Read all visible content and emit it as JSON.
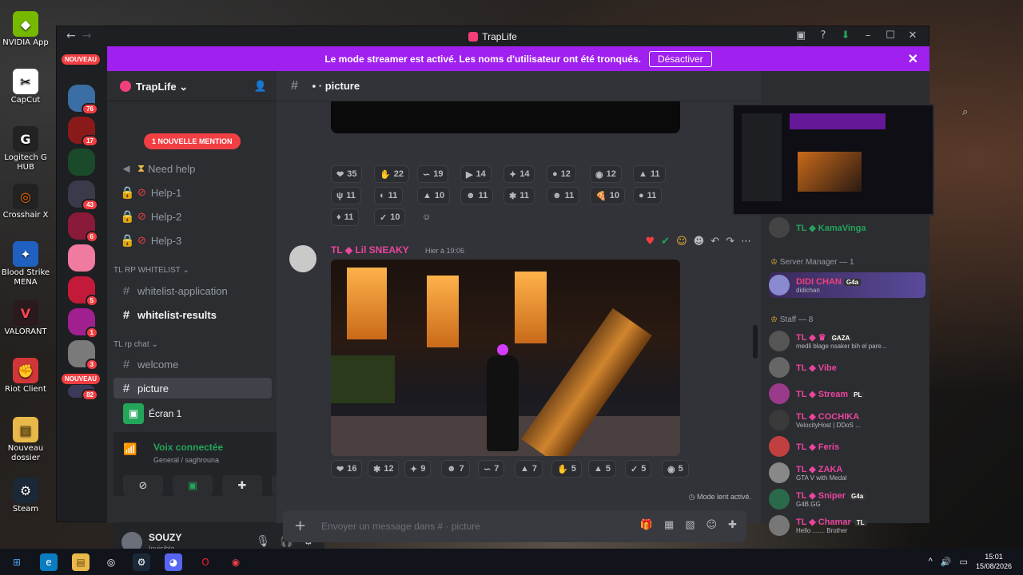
{
  "desktop": {
    "icons": [
      {
        "label": "NVIDIA App",
        "icon": "nvidia-icon",
        "color": "#76b900"
      },
      {
        "label": "CapCut",
        "icon": "capcut-icon",
        "color": "#111111"
      },
      {
        "label": "Logitech G HUB",
        "icon": "logitech-icon",
        "color": "#222222"
      },
      {
        "label": "Crosshair X",
        "icon": "crosshair-icon",
        "color": "#ff6a00"
      },
      {
        "label": "Blood Strike MENA",
        "icon": "bloodstrike-icon",
        "color": "#2060c0"
      },
      {
        "label": "VALORANT",
        "icon": "valorant-icon",
        "color": "#fa4454"
      },
      {
        "label": "Riot Client",
        "icon": "riot-icon",
        "color": "#d13639"
      },
      {
        "label": "Nouveau dossier",
        "icon": "folder-icon",
        "color": "#e8b84a"
      },
      {
        "label": "Steam",
        "icon": "steam-icon",
        "color": "#1b2838"
      }
    ]
  },
  "window": {
    "title": "TrapLife",
    "banner_text": "Le mode streamer est activé. Les noms d'utilisateur ont été tronqués.",
    "banner_button": "Désactiver"
  },
  "servers": {
    "new_label": "NOUVEAU",
    "badges": [
      "76",
      "17",
      "43",
      "6",
      "5",
      "1",
      "3",
      "82"
    ]
  },
  "sidebar": {
    "guild_name": "TrapLife",
    "mention_pill": "1 NOUVELLE MENTION",
    "channels": [
      {
        "label": "Need help"
      },
      {
        "label": "Help-1"
      },
      {
        "label": "Help-2"
      },
      {
        "label": "Help-3"
      }
    ],
    "category_whitelist": "TL RP WHITELIST",
    "whitelist_application": "whitelist-application",
    "whitelist_results": "whitelist-results",
    "category_chat": "TL rp chat",
    "welcome": "welcome",
    "picture": "picture",
    "screen_label": "Écran 1",
    "voice_status": "Voix connectée",
    "voice_channel": "General / saghrouna",
    "user_name": "SOUZY",
    "user_status": "Invisible"
  },
  "chat": {
    "channel_name": "picture",
    "reactions_top": [
      {
        "emoji": "❤",
        "count": "35"
      },
      {
        "emoji": "✋",
        "count": "22"
      },
      {
        "emoji": "∽",
        "count": "19"
      },
      {
        "emoji": "▶",
        "count": "14"
      },
      {
        "emoji": "✦",
        "count": "14"
      },
      {
        "emoji": "●",
        "count": "12"
      },
      {
        "emoji": "◉",
        "count": "12"
      },
      {
        "emoji": "▲",
        "count": "11"
      },
      {
        "emoji": "ψ",
        "count": "11"
      },
      {
        "emoji": "◐",
        "count": "11"
      },
      {
        "emoji": "▲",
        "count": "10"
      },
      {
        "emoji": "☻",
        "count": "11"
      },
      {
        "emoji": "✱",
        "count": "11"
      },
      {
        "emoji": "☻",
        "count": "11"
      },
      {
        "emoji": "🍕",
        "count": "10"
      },
      {
        "emoji": "●",
        "count": "11"
      },
      {
        "emoji": "♦",
        "count": "11"
      },
      {
        "emoji": "✓",
        "count": "10"
      }
    ],
    "author": "TL ◆ Lil SNEAKY",
    "time": "Hier à 19:06",
    "reactions_bottom": [
      {
        "emoji": "❤",
        "count": "16"
      },
      {
        "emoji": "✱",
        "count": "12"
      },
      {
        "emoji": "✦",
        "count": "9"
      },
      {
        "emoji": "☻",
        "count": "7"
      },
      {
        "emoji": "∽",
        "count": "7"
      },
      {
        "emoji": "▲",
        "count": "7"
      },
      {
        "emoji": "✋",
        "count": "5"
      },
      {
        "emoji": "▲",
        "count": "5"
      },
      {
        "emoji": "✓",
        "count": "5"
      },
      {
        "emoji": "◉",
        "count": "5"
      }
    ],
    "slow_mode": "Mode lent activé.",
    "composer_placeholder": "Envoyer un message dans #  · picture"
  },
  "members": {
    "top_member": "TL ◆ KamaVinga",
    "group_manager": "Server Manager — 1",
    "manager_name": "DIDI CHAN",
    "manager_tag": "G4a",
    "manager_sub": "didichan",
    "group_staff": "Staff — 8",
    "staff": [
      {
        "name": "TL ◆ ♛",
        "tag": "GAZA",
        "sub": "medli blage nsaker bih el pare...",
        "color": "#eb459e"
      },
      {
        "name": "TL ◆ Vibe",
        "tag": "",
        "sub": "",
        "color": "#eb459e"
      },
      {
        "name": "TL ◆ Stream",
        "tag": "PL",
        "sub": "",
        "color": "#eb459e"
      },
      {
        "name": "TL ◆ COCHIKA",
        "tag": "",
        "sub": "VelocityHost | DDoS ...",
        "color": "#eb459e"
      },
      {
        "name": "TL ◆ Feris",
        "tag": "",
        "sub": "",
        "color": "#eb459e"
      },
      {
        "name": "TL ◆ ZAKA",
        "tag": "",
        "sub": "GTA V with Medal",
        "color": "#eb459e"
      },
      {
        "name": "TL ◆ Sniper",
        "tag": "G4a",
        "sub": "G4B.GG",
        "color": "#eb459e"
      },
      {
        "name": "TL ◆ Chamar",
        "tag": "TL",
        "sub": "Hello ....... Brother",
        "color": "#eb459e"
      }
    ]
  },
  "taskbar": {
    "time": "15:01",
    "date": "15/08/2026"
  }
}
